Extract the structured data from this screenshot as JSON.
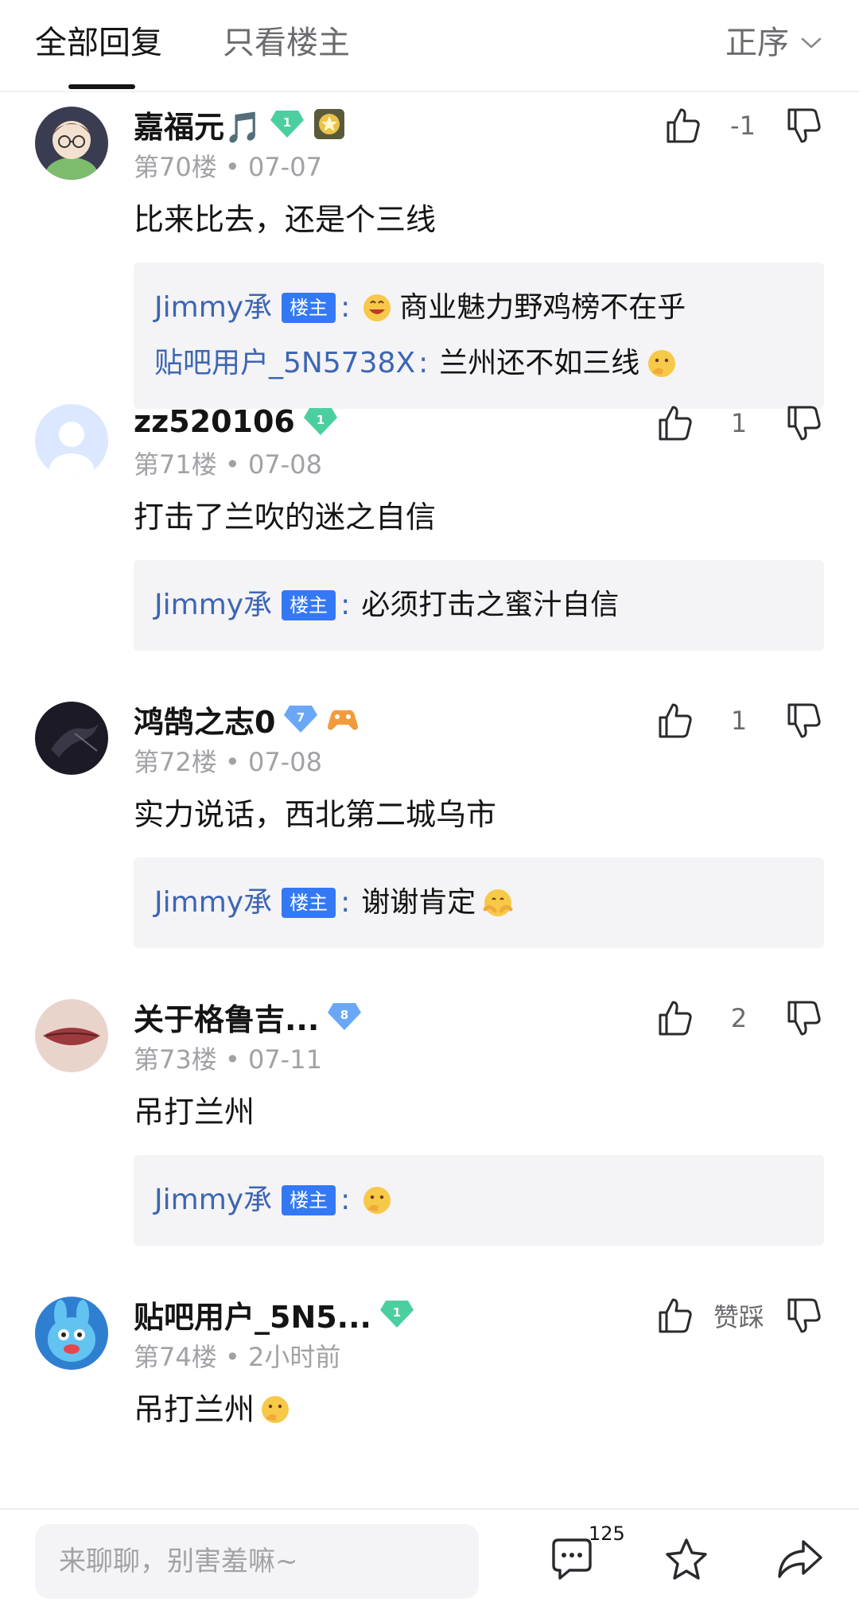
{
  "tabs": {
    "all": "全部回复",
    "host_only": "只看楼主"
  },
  "sort": {
    "label": "正序"
  },
  "posts": [
    {
      "username": "嘉福元🎵",
      "level": "1",
      "floor": "第70楼",
      "date": "07-07",
      "content": "比来比去，还是个三线",
      "vote_count": "-1",
      "replies": [
        {
          "name": "Jimmy承",
          "is_host": true,
          "host_tag": "楼主",
          "text": "商业魅力野鸡榜不在乎",
          "emoji_before": "grin-emoji",
          "emoji_after": ""
        },
        {
          "name": "贴吧用户_5N5738X",
          "is_host": false,
          "host_tag": "",
          "text": "兰州还不如三线",
          "emoji_before": "",
          "emoji_after": "thinking-emoji"
        }
      ]
    },
    {
      "username": "zz520106",
      "level": "1",
      "floor": "第71楼",
      "date": "07-08",
      "content": "打击了兰吹的迷之自信",
      "vote_count": "1",
      "replies": [
        {
          "name": "Jimmy承",
          "is_host": true,
          "host_tag": "楼主",
          "text": "必须打击之蜜汁自信",
          "emoji_before": "",
          "emoji_after": ""
        }
      ]
    },
    {
      "username": "鸿鹄之志0",
      "level": "7",
      "floor": "第72楼",
      "date": "07-08",
      "content": "实力说话，西北第二城乌市",
      "vote_count": "1",
      "replies": [
        {
          "name": "Jimmy承",
          "is_host": true,
          "host_tag": "楼主",
          "text": "谢谢肯定",
          "emoji_before": "",
          "emoji_after": "hug-emoji"
        }
      ]
    },
    {
      "username": "关于格鲁吉...",
      "level": "8",
      "floor": "第73楼",
      "date": "07-11",
      "content": "吊打兰州",
      "vote_count": "2",
      "replies": [
        {
          "name": "Jimmy承",
          "is_host": true,
          "host_tag": "楼主",
          "text": "",
          "emoji_before": "",
          "emoji_after": "thinking-emoji"
        }
      ]
    },
    {
      "username": "贴吧用户_5N5...",
      "level": "1",
      "floor": "第74楼",
      "date": "2小时前",
      "content": "吊打兰州",
      "vote_count": "赞踩",
      "replies": []
    }
  ],
  "bottom_bar": {
    "input_placeholder": "来聊聊，别害羞嘛~",
    "comment_count": "125"
  },
  "colors": {
    "accent_blue": "#3478f6",
    "reply_name_blue": "#3c66b3",
    "level_green": "#4ccf9f",
    "level_blue": "#6aa8f7",
    "reply_bg": "#f4f3f6"
  }
}
